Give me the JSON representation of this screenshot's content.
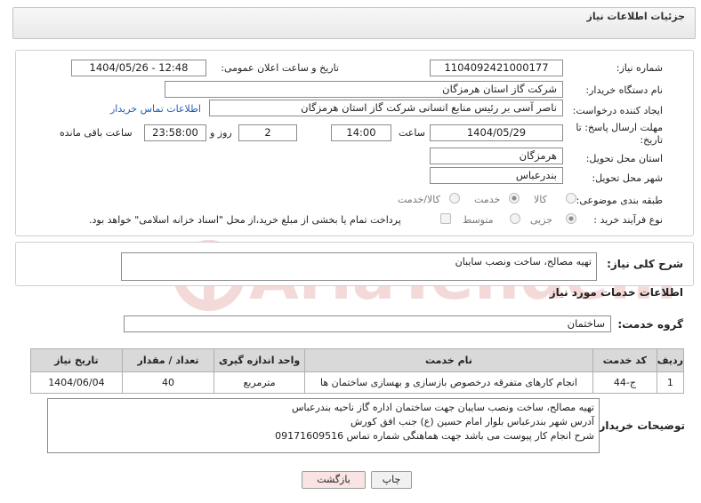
{
  "header": {
    "title": "جزئیات اطلاعات نیاز"
  },
  "form": {
    "need_number_label": "شماره نیاز:",
    "need_number": "1104092421000177",
    "announce_label": "تاریخ و ساعت اعلان عمومی:",
    "announce_value": "1404/05/26 - 12:48",
    "buyer_label": "نام دستگاه خریدار:",
    "buyer_value": "شرکت گاز استان هرمزگان",
    "creator_label": "ایجاد کننده درخواست:",
    "creator_value": "ناصر آسی بر رئیس منابع انسانی شرکت گاز استان هرمزگان",
    "contact_link": "اطلاعات تماس خریدار",
    "deadline_label": "مهلت ارسال پاسخ: تا تاریخ:",
    "deadline_date": "1404/05/29",
    "time_label": "ساعت",
    "deadline_time": "14:00",
    "days_value": "2",
    "days_label": "روز و",
    "remaining_time": "23:58:00",
    "remaining_label": "ساعت باقی مانده",
    "province_label": "استان محل تحویل:",
    "province_value": "هرمزگان",
    "city_label": "شهر محل تحویل:",
    "city_value": "بندرعباس",
    "category_label": "طبقه بندی موضوعی:",
    "category_options": [
      "کالا",
      "خدمت",
      "کالا/خدمت"
    ],
    "category_selected": 1,
    "process_label": "نوع فرآیند خرید :",
    "process_options": [
      "جزیی",
      "متوسط"
    ],
    "process_selected": 0,
    "payment_note": "پرداخت تمام یا بخشی از مبلغ خرید،از محل \"اسناد خزانه اسلامی\" خواهد بود."
  },
  "summary": {
    "label": "شرح کلی نیاز:",
    "value": "تهیه مصالح، ساخت ونصب سایبان"
  },
  "services": {
    "section_title": "اطلاعات خدمات مورد نیاز",
    "group_label": "گروه خدمت:",
    "group_value": "ساختمان",
    "columns": [
      "ردیف",
      "کد خدمت",
      "نام خدمت",
      "واحد اندازه گیری",
      "تعداد / مقدار",
      "تاریخ نیاز"
    ],
    "rows": [
      [
        "1",
        "ج-44",
        "انجام کارهای متفرقه درخصوص بازسازی و بهسازی ساختمان ها",
        "مترمربع",
        "40",
        "1404/06/04"
      ]
    ]
  },
  "buyer_notes": {
    "label": "توضیحات خریدار:",
    "lines": [
      "تهیه مصالح، ساخت ونصب سایبان جهت ساختمان اداره گاز ناحیه بندرعباس",
      "آدرس شهر بندرعباس بلوار امام حسین (ع) جنب افق کورش",
      "شرح انجام کار پیوست می باشد جهت هماهنگی شماره تماس 09171609516"
    ]
  },
  "buttons": {
    "print": "چاپ",
    "back": "بازگشت"
  },
  "watermark": {
    "text": "AriaTender.net"
  },
  "colors": {
    "link": "#1f5fb4",
    "table_header": "#d9d9d9",
    "back_button": "#f9e3e3",
    "watermark": "#c0392b"
  }
}
